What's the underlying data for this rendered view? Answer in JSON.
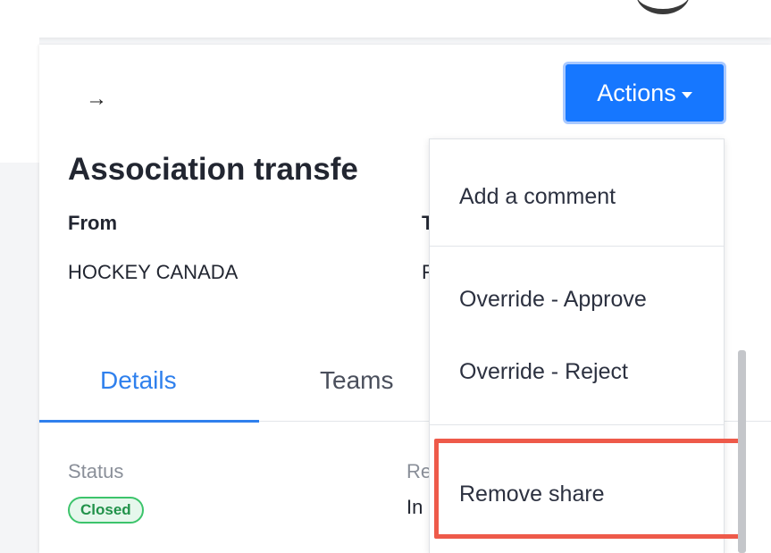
{
  "header": {
    "back_icon": "arrow-right-icon",
    "actions_label": "Actions",
    "actions_color": "#1677ff"
  },
  "detail": {
    "title": "Association transfe",
    "from_label": "From",
    "from_value": "HOCKEY CANADA",
    "to_label_peek": "T",
    "to_value_peek": "F"
  },
  "tabs": [
    {
      "label": "Details",
      "active": true
    },
    {
      "label": "Teams",
      "active": false
    }
  ],
  "fields": {
    "status_label": "Status",
    "status_value": "Closed",
    "status_color": "#3cc46b",
    "second_label_peek": "Re",
    "second_value_peek": "In"
  },
  "actions_menu": {
    "items": [
      {
        "label": "Add a comment"
      },
      {
        "label": "Override - Approve"
      },
      {
        "label": "Override - Reject"
      },
      {
        "label": "Remove share"
      }
    ],
    "highlight_color": "#ee5a4a"
  }
}
